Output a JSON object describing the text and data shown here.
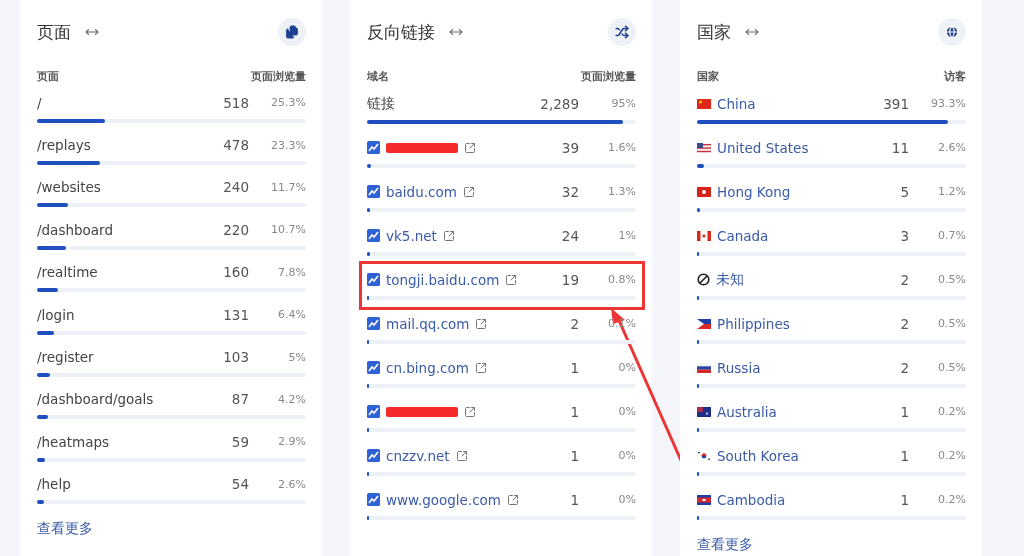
{
  "cards": [
    {
      "title": "页面",
      "kind": "pages",
      "header": {
        "left": "页面",
        "right": "页面浏览量"
      },
      "more": "查看更多",
      "rows": [
        {
          "kind": "page",
          "label": "/",
          "count": "518",
          "share": "25.3%",
          "level": 0.253
        },
        {
          "kind": "page",
          "label": "/replays",
          "count": "478",
          "share": "23.3%",
          "level": 0.233
        },
        {
          "kind": "page",
          "label": "/websites",
          "count": "240",
          "share": "11.7%",
          "level": 0.117
        },
        {
          "kind": "page",
          "label": "/dashboard",
          "count": "220",
          "share": "10.7%",
          "level": 0.107
        },
        {
          "kind": "page",
          "label": "/realtime",
          "count": "160",
          "share": "7.8%",
          "level": 0.078
        },
        {
          "kind": "page",
          "label": "/login",
          "count": "131",
          "share": "6.4%",
          "level": 0.064
        },
        {
          "kind": "page",
          "label": "/register",
          "count": "103",
          "share": "5%",
          "level": 0.05
        },
        {
          "kind": "page",
          "label": "/dashboard/goals",
          "count": "87",
          "share": "4.2%",
          "level": 0.042
        },
        {
          "kind": "page",
          "label": "/heatmaps",
          "count": "59",
          "share": "2.9%",
          "level": 0.029
        },
        {
          "kind": "page",
          "label": "/help",
          "count": "54",
          "share": "2.6%",
          "level": 0.026
        }
      ]
    },
    {
      "title": "反向链接",
      "kind": "referrers",
      "header": {
        "left": "域名",
        "right": "页面浏览量"
      },
      "rows": [
        {
          "kind": "total",
          "label": "链接",
          "count": "2,289",
          "share": "95%",
          "level": 0.95
        },
        {
          "kind": "redacted",
          "count": "39",
          "share": "1.6%",
          "level": 0.016
        },
        {
          "kind": "link",
          "label": "baidu.com",
          "count": "32",
          "share": "1.3%",
          "level": 0.013
        },
        {
          "kind": "link",
          "label": "vk5.net",
          "count": "24",
          "share": "1%",
          "level": 0.01
        },
        {
          "kind": "link",
          "label": "tongji.baidu.com",
          "count": "19",
          "share": "0.8%",
          "level": 0.008,
          "highlighted": true
        },
        {
          "kind": "link",
          "label": "mail.qq.com",
          "count": "2",
          "share": "0.1%",
          "level": 0.004
        },
        {
          "kind": "link",
          "label": "cn.bing.com",
          "count": "1",
          "share": "0%",
          "level": 0.002
        },
        {
          "kind": "redacted",
          "count": "1",
          "share": "0%",
          "level": 0.002
        },
        {
          "kind": "link",
          "label": "cnzzv.net",
          "count": "1",
          "share": "0%",
          "level": 0.002
        },
        {
          "kind": "link",
          "label": "www.google.com",
          "count": "1",
          "share": "0%",
          "level": 0.002
        }
      ]
    },
    {
      "title": "国家",
      "kind": "countries",
      "header": {
        "left": "国家",
        "right": "访客"
      },
      "more": "查看更多",
      "rows": [
        {
          "kind": "cn",
          "label": "China",
          "count": "391",
          "share": "93.3%",
          "level": 0.933
        },
        {
          "kind": "us",
          "label": "United States",
          "count": "11",
          "share": "2.6%",
          "level": 0.026
        },
        {
          "kind": "hk",
          "label": "Hong Kong",
          "count": "5",
          "share": "1.2%",
          "level": 0.012
        },
        {
          "kind": "ca",
          "label": "Canada",
          "count": "3",
          "share": "0.7%",
          "level": 0.007
        },
        {
          "kind": "unknown",
          "label": "未知",
          "count": "2",
          "share": "0.5%",
          "level": 0.005
        },
        {
          "kind": "ph",
          "label": "Philippines",
          "count": "2",
          "share": "0.5%",
          "level": 0.005
        },
        {
          "kind": "ru",
          "label": "Russia",
          "count": "2",
          "share": "0.5%",
          "level": 0.005
        },
        {
          "kind": "au",
          "label": "Australia",
          "count": "1",
          "share": "0.2%",
          "level": 0.002
        },
        {
          "kind": "kr",
          "label": "South Korea",
          "count": "1",
          "share": "0.2%",
          "level": 0.002
        },
        {
          "kind": "kh",
          "label": "Cambodia",
          "count": "1",
          "share": "0.2%",
          "level": 0.002
        }
      ]
    }
  ]
}
